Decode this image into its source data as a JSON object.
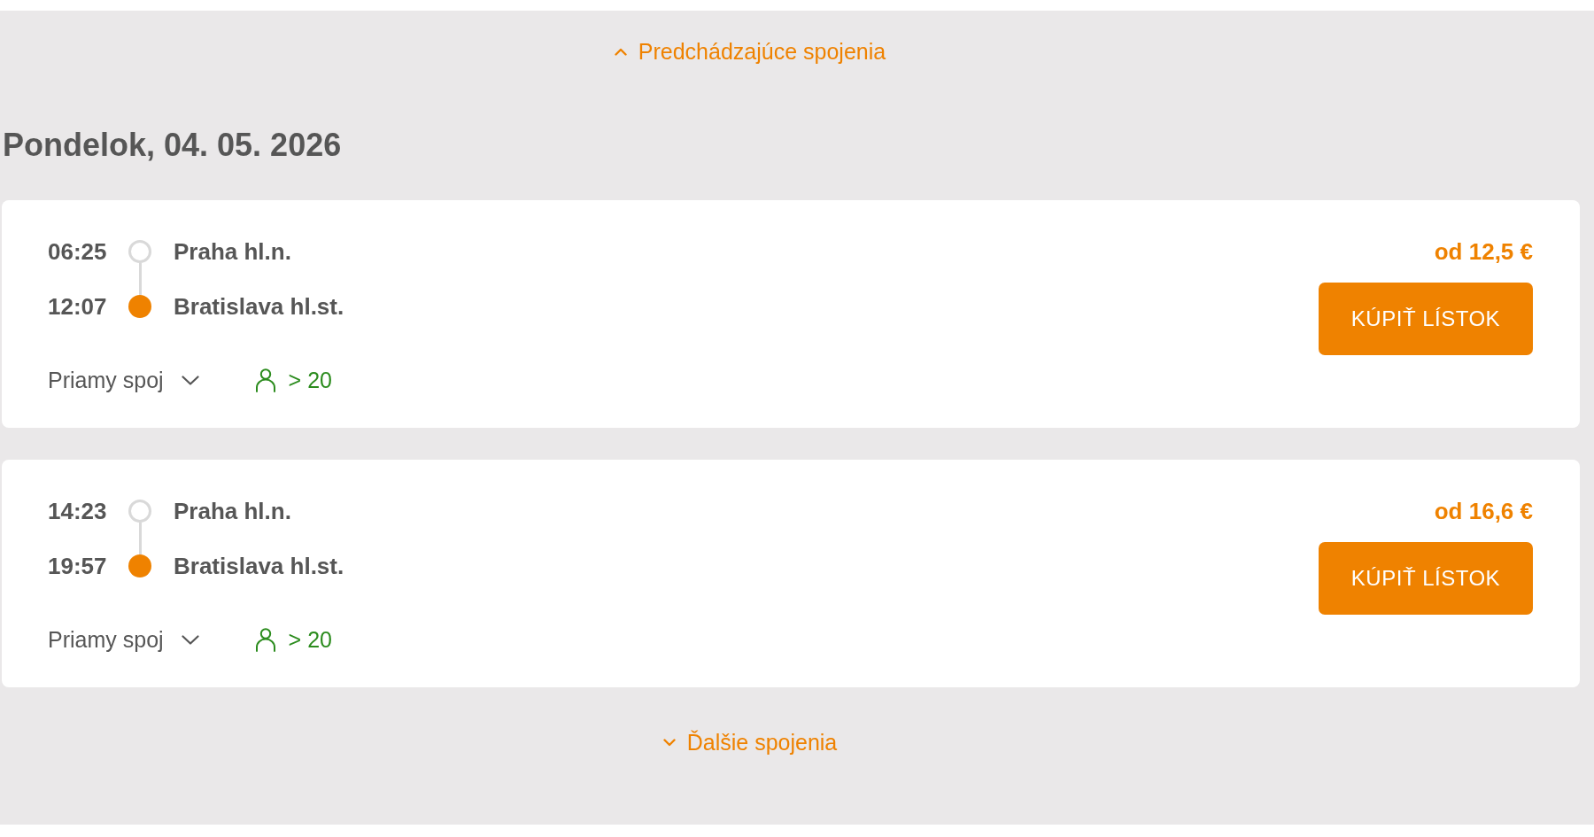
{
  "previous_link": {
    "label": "Predchádzajúce spojenia"
  },
  "day_heading": "Pondelok, 04. 05. 2026",
  "connections": [
    {
      "stops": [
        {
          "kind": "departure",
          "time": "06:25",
          "station": "Praha hl.n."
        },
        {
          "kind": "arrival",
          "time": "12:07",
          "station": "Bratislava hl.st."
        }
      ],
      "type_label": "Priamy spoj",
      "expanded": false,
      "free_seats": "> 20",
      "price": "od 12,5 €",
      "buy_button": "KÚPIŤ LÍSTOK"
    },
    {
      "stops": [
        {
          "kind": "departure",
          "time": "14:23",
          "station": "Praha hl.n."
        },
        {
          "kind": "arrival",
          "time": "19:57",
          "station": "Bratislava hl.st."
        }
      ],
      "type_label": "Priamy spoj",
      "expanded": false,
      "free_seats": "> 20",
      "price": "od 16,6 €",
      "buy_button": "KÚPIŤ LÍSTOK"
    }
  ],
  "next_link": {
    "label": "Ďalšie spojenia"
  }
}
